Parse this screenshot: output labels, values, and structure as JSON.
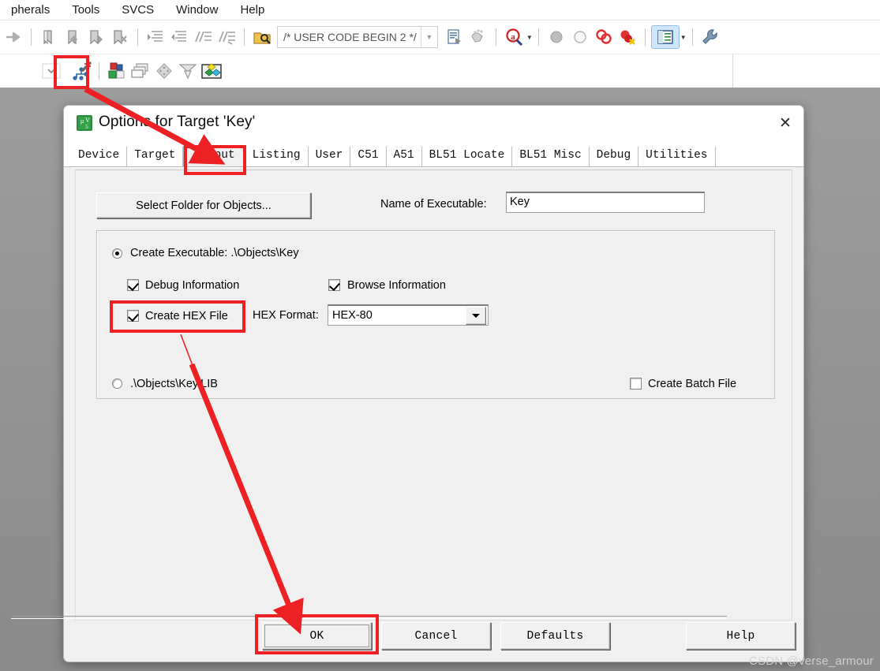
{
  "ide": {
    "menubar": [
      "pherals",
      "Tools",
      "SVCS",
      "Window",
      "Help"
    ],
    "toolbar_row1": [
      {
        "name": "arrow-right-icon"
      },
      {
        "name": "bookmark-toggle-icon"
      },
      {
        "name": "bookmark-prev-icon"
      },
      {
        "name": "bookmark-next-icon"
      },
      {
        "name": "bookmark-clear-icon"
      },
      {
        "name": "indent-icon"
      },
      {
        "name": "outdent-icon"
      },
      {
        "name": "comment-lines-icon"
      },
      {
        "name": "uncomment-lines-icon"
      },
      {
        "name": "find-in-files-icon"
      }
    ],
    "code_combo": {
      "value": "/* USER CODE BEGIN 2 */"
    },
    "toolbar_row1_right": [
      {
        "name": "insert-bookmark-icon"
      },
      {
        "name": "step-icon"
      },
      {
        "name": "magnifier-q-icon"
      },
      {
        "name": "breakpoint-disabled-icon"
      },
      {
        "name": "breakpoint-empty-icon"
      },
      {
        "name": "breakpoints-icon"
      },
      {
        "name": "kill-breakpoints-icon"
      },
      {
        "name": "project-window-icon"
      },
      {
        "name": "configure-wrench-icon"
      }
    ],
    "toolbar_row2": [
      {
        "name": "chevron-down-icon"
      },
      {
        "name": "target-options-wand-icon"
      },
      {
        "name": "manage-project-items-icon"
      },
      {
        "name": "batch-build-icon"
      },
      {
        "name": "rebuild-icon"
      },
      {
        "name": "translate-icon"
      },
      {
        "name": "target-select-icon"
      }
    ]
  },
  "dialog": {
    "title": "Options for Target 'Key'",
    "icon_name": "keil-uvision5-icon",
    "close_label": "✕",
    "tabs": [
      {
        "label": "Device",
        "selected": false
      },
      {
        "label": "Target",
        "selected": false
      },
      {
        "label": "Output",
        "selected": true
      },
      {
        "label": "Listing",
        "selected": false
      },
      {
        "label": "User",
        "selected": false
      },
      {
        "label": "C51",
        "selected": false
      },
      {
        "label": "A51",
        "selected": false
      },
      {
        "label": "BL51 Locate",
        "selected": false
      },
      {
        "label": "BL51 Misc",
        "selected": false
      },
      {
        "label": "Debug",
        "selected": false
      },
      {
        "label": "Utilities",
        "selected": false
      }
    ],
    "output_tab": {
      "select_folder_button": "Select Folder for Objects...",
      "name_of_executable_label": "Name of Executable:",
      "name_of_executable_value": "Key",
      "create_executable": {
        "label": "Create Executable:  .\\Objects\\Key",
        "checked": true
      },
      "debug_information": {
        "label": "Debug Information",
        "checked": true
      },
      "browse_information": {
        "label": "Browse Information",
        "checked": true
      },
      "create_hex_file": {
        "label": "Create HEX File",
        "checked": true
      },
      "hex_format_label": "HEX Format:",
      "hex_format_value": "HEX-80",
      "create_library": {
        "label": ".\\Objects\\Key.LIB",
        "checked": false
      },
      "create_batch_file": {
        "label": "Create Batch File",
        "checked": false
      }
    },
    "buttons": {
      "ok": "OK",
      "cancel": "Cancel",
      "defaults": "Defaults",
      "help": "Help"
    }
  },
  "annotations": {
    "highlight_color": "#ed2024",
    "boxes": [
      {
        "name": "toolbar-target-options-highlight"
      },
      {
        "name": "output-tab-highlight"
      },
      {
        "name": "create-hex-file-highlight"
      },
      {
        "name": "ok-button-highlight"
      }
    ],
    "arrows": [
      {
        "name": "arrow-toolbar-to-output-tab"
      },
      {
        "name": "arrow-hex-to-ok"
      }
    ]
  },
  "watermark": "CSDN @verse_armour"
}
